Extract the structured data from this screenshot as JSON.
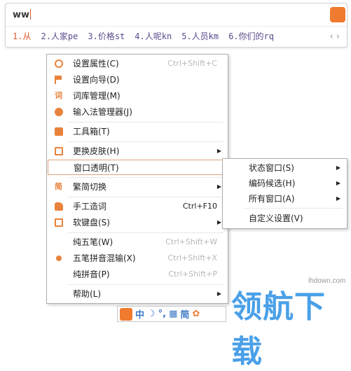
{
  "candidate_window": {
    "composition": "ww",
    "candidates": [
      {
        "index": "1.",
        "text": "从"
      },
      {
        "index": "2.",
        "text": "人家pe"
      },
      {
        "index": "3.",
        "text": "价格st"
      },
      {
        "index": "4.",
        "text": "人呢kn"
      },
      {
        "index": "5.",
        "text": "人员km"
      },
      {
        "index": "6.",
        "text": "你们的rq"
      }
    ],
    "pager": "‹›"
  },
  "context_menu": {
    "items": [
      {
        "icon": "gear-icon",
        "label": "设置属性(C)",
        "shortcut": "Ctrl+Shift+C"
      },
      {
        "icon": "flag-icon",
        "label": "设置向导(D)",
        "shortcut": ""
      },
      {
        "icon": "lexicon-icon",
        "label": "词库管理(M)",
        "shortcut": ""
      },
      {
        "icon": "input-manager-icon",
        "label": "输入法管理器(J)",
        "shortcut": ""
      },
      {
        "icon": "toolbox-icon",
        "label": "工具箱(T)",
        "shortcut": ""
      },
      {
        "icon": "shirt-icon",
        "label": "更换皮肤(H)",
        "shortcut": "",
        "submenu": true
      },
      {
        "icon": "",
        "label": "窗口透明(T)",
        "shortcut": "",
        "highlighted": true
      },
      {
        "icon": "simplified-traditional-icon",
        "label": "繁简切换",
        "shortcut": "",
        "submenu": true
      },
      {
        "icon": "hand-icon",
        "label": "手工造词",
        "shortcut": "Ctrl+F10"
      },
      {
        "icon": "keyboard-icon",
        "label": "软键盘(S)",
        "shortcut": "",
        "submenu": true
      },
      {
        "icon": "",
        "label": "纯五笔(W)",
        "shortcut": "Ctrl+Shift+W"
      },
      {
        "icon": "radio-dot-icon",
        "label": "五笔拼音混输(X)",
        "shortcut": "Ctrl+Shift+X"
      },
      {
        "icon": "",
        "label": "纯拼音(P)",
        "shortcut": "Ctrl+Shift+P"
      },
      {
        "icon": "",
        "label": "帮助(L)",
        "shortcut": "",
        "submenu": true
      }
    ],
    "submenu_arrow": "▶"
  },
  "sub_menu": {
    "items": [
      {
        "label": "状态窗口(S)",
        "submenu": true
      },
      {
        "label": "编码候选(H)",
        "submenu": true
      },
      {
        "label": "所有窗口(A)",
        "submenu": true
      },
      {
        "label": "自定义设置(V)",
        "submenu": false
      }
    ]
  },
  "status_bar": {
    "items": [
      "中",
      "☽",
      "°,",
      "▦",
      "简",
      "✿"
    ]
  },
  "watermark": {
    "text": "领航下载",
    "url": "lhdown.com"
  },
  "colors": {
    "accent": "#e8823c",
    "candidate_index": "#5a4a8c",
    "status_blue": "#3b78c4",
    "watermark": "#4aa0e8"
  }
}
